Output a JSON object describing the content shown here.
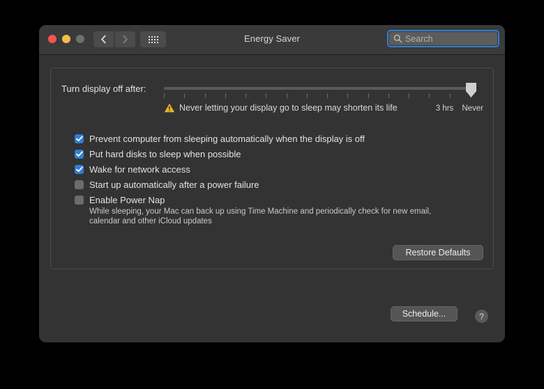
{
  "window": {
    "title": "Energy Saver",
    "traffic_lights": [
      {
        "name": "close",
        "color": "#f4544c"
      },
      {
        "name": "minimize",
        "color": "#f5bd4f"
      },
      {
        "name": "zoom",
        "color": "#6e6e6e"
      }
    ],
    "nav": {
      "back_icon": "chevron-left-icon",
      "forward_icon": "chevron-right-icon",
      "show_all_icon": "grid-dots-icon"
    },
    "search": {
      "placeholder": "Search",
      "value": "",
      "icon": "search-icon",
      "focus_ring_color": "#2f7fd1"
    }
  },
  "slider": {
    "label": "Turn display off after:",
    "tick_count": 16,
    "value_position_percent": 100,
    "end_labels": [
      "3 hrs",
      "Never"
    ],
    "warning": {
      "icon": "warning-triangle-icon",
      "color": "#e8b42c",
      "text": "Never letting your display go to sleep may shorten its life"
    }
  },
  "options": [
    {
      "label": "Prevent computer from sleeping automatically when the display is off",
      "checked": true
    },
    {
      "label": "Put hard disks to sleep when possible",
      "checked": true
    },
    {
      "label": "Wake for network access",
      "checked": true
    },
    {
      "label": "Start up automatically after a power failure",
      "checked": false
    },
    {
      "label": "Enable Power Nap",
      "checked": false,
      "description": "While sleeping, your Mac can back up using Time Machine and periodically check for new email, calendar and other iCloud updates"
    }
  ],
  "buttons": {
    "restore_defaults": "Restore Defaults",
    "schedule": "Schedule...",
    "help": "?"
  },
  "colors": {
    "accent_blue": "#2f7fd1",
    "window_bg": "#333333",
    "titlebar_bg": "#3a3a3a",
    "warning_yellow": "#e8b42c"
  }
}
